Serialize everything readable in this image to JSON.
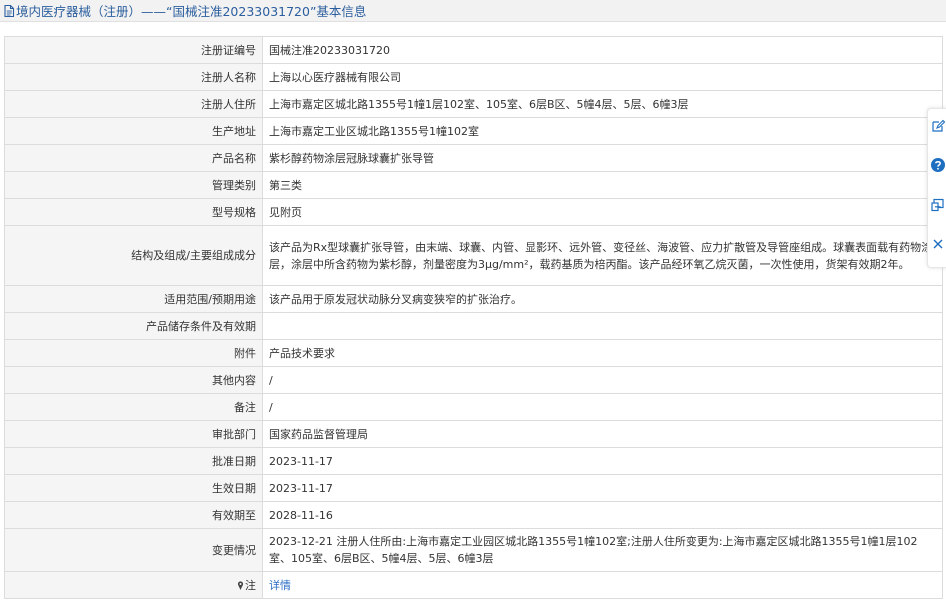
{
  "header": {
    "title": "境内医疗器械（注册）——“国械注准20233031720”基本信息",
    "icon": "document-icon",
    "title_color": "#2b5e9e"
  },
  "rows": [
    {
      "label": "注册证编号",
      "value": "国械注准20233031720"
    },
    {
      "label": "注册人名称",
      "value": "上海以心医疗器械有限公司"
    },
    {
      "label": "注册人住所",
      "value": "上海市嘉定区城北路1355号1幢1层102室、105室、6层B区、5幢4层、5层、6幢3层"
    },
    {
      "label": "生产地址",
      "value": "上海市嘉定工业区城北路1355号1幢102室"
    },
    {
      "label": "产品名称",
      "value": "紫杉醇药物涂层冠脉球囊扩张导管"
    },
    {
      "label": "管理类别",
      "value": "第三类"
    },
    {
      "label": "型号规格",
      "value": "见附页"
    },
    {
      "label": "结构及组成/主要组成成分",
      "value": "该产品为Rx型球囊扩张导管，由末端、球囊、内管、显影环、远外管、变径丝、海波管、应力扩散管及导管座组成。球囊表面载有药物涂层，涂层中所含药物为紫杉醇，剂量密度为3μg/mm²，载药基质为棓丙酯。该产品经环氧乙烷灭菌，一次性使用，货架有效期2年。"
    },
    {
      "label": "适用范围/预期用途",
      "value": "该产品用于原发冠状动脉分叉病变狭窄的扩张治疗。"
    },
    {
      "label": "产品储存条件及有效期",
      "value": ""
    },
    {
      "label": "附件",
      "value": "产品技术要求"
    },
    {
      "label": "其他内容",
      "value": "/"
    },
    {
      "label": "备注",
      "value": "/"
    },
    {
      "label": "审批部门",
      "value": "国家药品监督管理局"
    },
    {
      "label": "批准日期",
      "value": "2023-11-17"
    },
    {
      "label": "生效日期",
      "value": "2023-11-17"
    },
    {
      "label": "有效期至",
      "value": "2028-11-16"
    },
    {
      "label": "变更情况",
      "value": "2023-12-21 注册人住所由:上海市嘉定工业园区城北路1355号1幢102室;注册人住所变更为:上海市嘉定区城北路1355号1幢1层102室、105室、6层B区、5幢4层、5层、6幢3层"
    }
  ],
  "note": {
    "label": "注",
    "icon": "pin-icon",
    "link_text": "详情",
    "link_color": "#2b6cc4"
  },
  "side_toolbar": {
    "icons": [
      "edit-icon",
      "help-icon",
      "share-icon",
      "close-icon"
    ],
    "accent": "#1f6fc0"
  }
}
